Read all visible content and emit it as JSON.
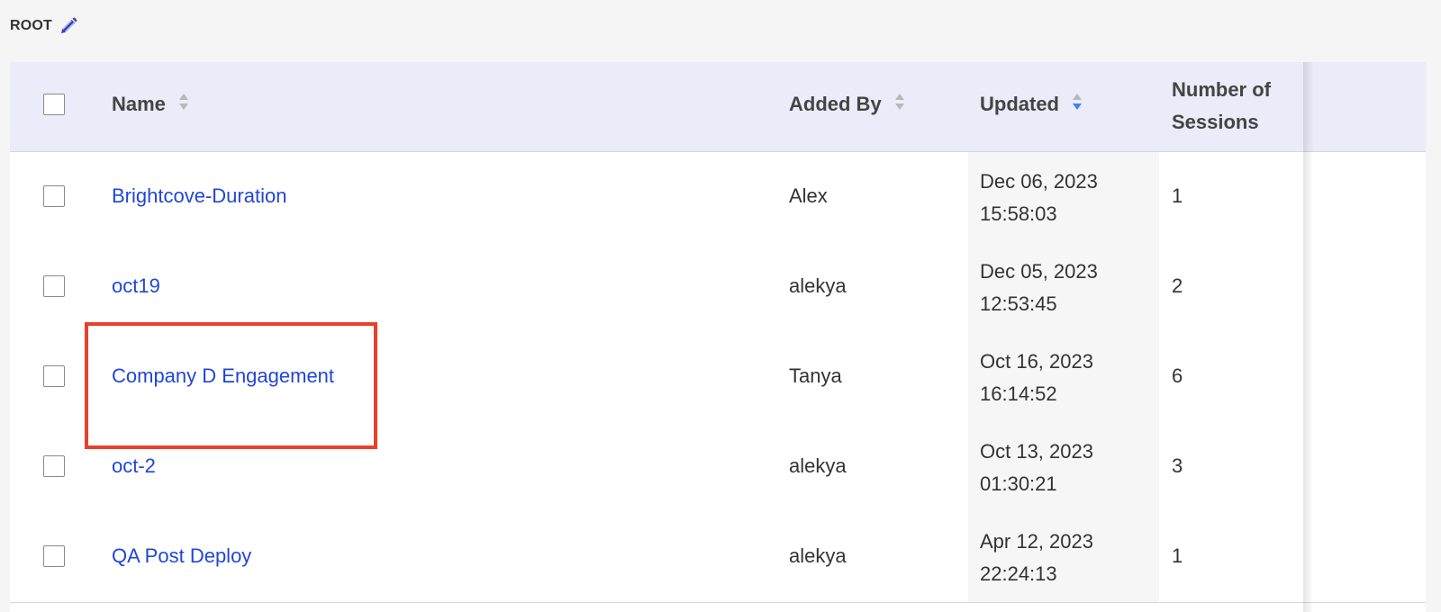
{
  "breadcrumb": {
    "label": "ROOT",
    "edit_icon": "pencil-icon",
    "icon_color": "#3b3fc4"
  },
  "table": {
    "columns": {
      "name": "Name",
      "added_by": "Added By",
      "updated": "Updated",
      "sessions_line1": "Number of",
      "sessions_line2": "Sessions"
    },
    "sort_active_column": "Updated",
    "sort_active_direction": "descending",
    "rows": [
      {
        "name": "Brightcove-Duration",
        "added_by": "Alex",
        "updated_date": "Dec 06, 2023",
        "updated_time": "15:58:03",
        "sessions": "1"
      },
      {
        "name": "oct19",
        "added_by": "alekya",
        "updated_date": "Dec 05, 2023",
        "updated_time": "12:53:45",
        "sessions": "2"
      },
      {
        "name": "Company D Engagement",
        "added_by": "Tanya",
        "updated_date": "Oct 16, 2023",
        "updated_time": "16:14:52",
        "sessions": "6"
      },
      {
        "name": "oct-2",
        "added_by": "alekya",
        "updated_date": "Oct 13, 2023",
        "updated_time": "01:30:21",
        "sessions": "3"
      },
      {
        "name": "QA Post Deploy",
        "added_by": "alekya",
        "updated_date": "Apr 12, 2023",
        "updated_time": "22:24:13",
        "sessions": "1"
      }
    ]
  },
  "colors": {
    "link": "#2146d8",
    "header_bg": "#ebebf9",
    "highlight": "#e8402a",
    "sort_active": "#3b82f6"
  }
}
